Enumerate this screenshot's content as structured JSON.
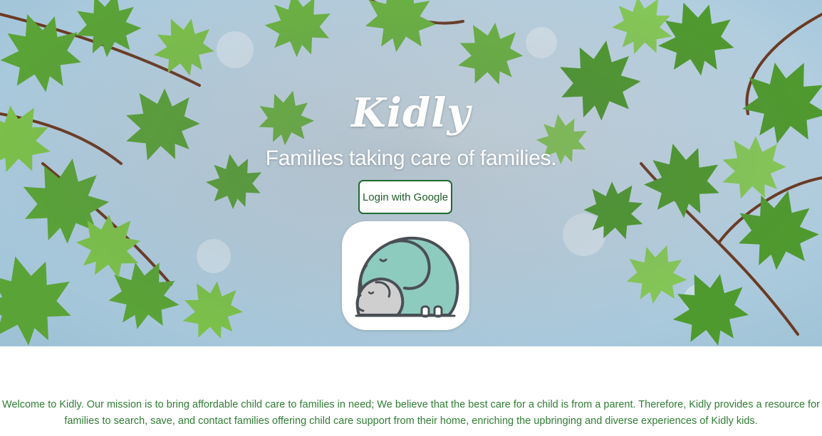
{
  "hero": {
    "brand": "Kidly",
    "tagline": "Families taking care of families.",
    "login_label": "Login with Google",
    "logo_icon": "elephant-family-icon",
    "background": "maple-leaves-sky"
  },
  "mission": {
    "text": "Welcome to Kidly. Our mission is to bring affordable child care to families in need; We believe that the best care for a child is from a parent. Therefore, Kidly provides a resource for families to search, save, and contact families offering child care support from their home, enriching the upbringing and diverse experiences of Kidly kids."
  },
  "colors": {
    "accent_green": "#1e6b2c",
    "text_green": "#2f7d33",
    "elephant_teal": "#8ecbbf",
    "elephant_gray": "#cfcfcf"
  }
}
